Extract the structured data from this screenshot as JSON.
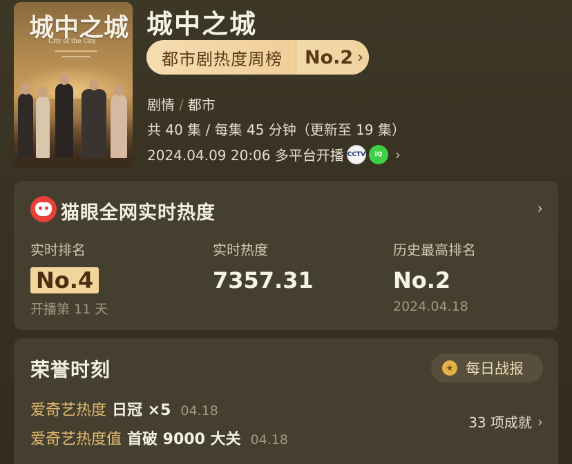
{
  "show": {
    "title": "城中之城",
    "poster_title": "城中之城",
    "poster_subtitle": "City of the City",
    "rank_label": "都市剧热度周榜",
    "rank_value": "No.2",
    "genres": [
      "剧情",
      "都市"
    ],
    "episodes_info": "共 40 集 / 每集 45 分钟（更新至 19 集）",
    "release": "2024.04.09 20:06 多平台开播",
    "platforms": [
      {
        "name": "CCTV",
        "icon": "cctv-icon"
      },
      {
        "name": "爱奇艺",
        "icon": "iqiyi-icon"
      }
    ]
  },
  "heat": {
    "title": "猫眼全网实时热度",
    "stats": [
      {
        "label": "实时排名",
        "value": "No.4",
        "sub": "开播第 11 天"
      },
      {
        "label": "实时热度",
        "value": "7357.31",
        "sub": ""
      },
      {
        "label": "历史最高排名",
        "value": "No.2",
        "sub": "2024.04.18"
      }
    ]
  },
  "honor": {
    "title": "荣誉时刻",
    "daily_button": "每日战报",
    "items": [
      {
        "source": "爱奇艺热度",
        "achievement": "日冠 ×5",
        "date": "04.18"
      },
      {
        "source": "爱奇艺热度值",
        "achievement": "首破 9000 大关",
        "date": "04.18"
      }
    ],
    "count_label": "33 项成就"
  },
  "colors": {
    "background": "#3a3424",
    "card": "#453f2f",
    "badge_gold": "#f0cf9a",
    "rank_highlight": "#f2d49c",
    "honor_source": "#e5bc72",
    "maoyan_red": "#e8413a",
    "iqiyi_green": "#3fd045"
  }
}
